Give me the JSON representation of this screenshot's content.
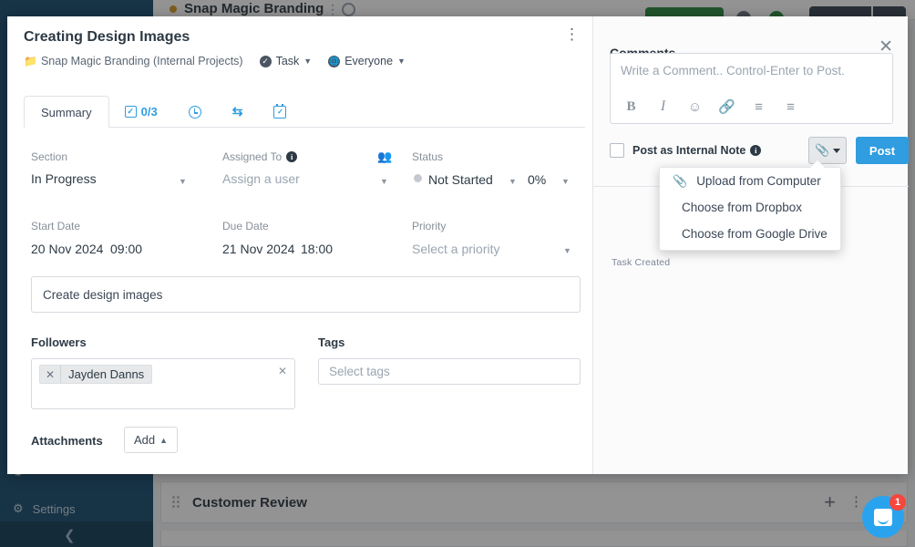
{
  "background": {
    "topbar": {
      "project_name": "Snap Magic Branding",
      "kebab": "⋮"
    },
    "sidebar": {
      "items": [
        {
          "label": "Settings",
          "icon": "gear-icon"
        }
      ]
    },
    "section_row": {
      "title": "Customer Review",
      "add": "+",
      "kebab": "⋮",
      "close": "✕"
    },
    "chat": {
      "badge": "1"
    }
  },
  "modal": {
    "title": "Creating Design Images",
    "kebab": "⋮",
    "breadcrumb": {
      "project": "Snap Magic Branding (Internal Projects)",
      "type": "Task",
      "visibility": "Everyone"
    },
    "tabs": [
      {
        "label": "Summary",
        "icon": ""
      },
      {
        "label": "0/3",
        "icon": "checkbox-icon"
      },
      {
        "label": "",
        "icon": "clock-icon"
      },
      {
        "label": "",
        "icon": "repeat-icon"
      },
      {
        "label": "",
        "icon": "calendar-icon"
      }
    ],
    "fields": {
      "section": {
        "label": "Section",
        "value": "In Progress"
      },
      "assigned_to": {
        "label": "Assigned To",
        "value": "Assign a user",
        "is_placeholder": true
      },
      "status": {
        "label": "Status",
        "value": "Not Started",
        "percent": "0%"
      },
      "start_date": {
        "label": "Start Date",
        "date": "20 Nov 2024",
        "time": "09:00"
      },
      "due_date": {
        "label": "Due Date",
        "date": "21 Nov 2024",
        "time": "18:00"
      },
      "priority": {
        "label": "Priority",
        "value": "Select a priority",
        "is_placeholder": true
      }
    },
    "description": "Create design images",
    "followers": {
      "label": "Followers",
      "chips": [
        "Jayden Danns"
      ]
    },
    "tags": {
      "label": "Tags",
      "placeholder": "Select tags"
    },
    "attachments": {
      "label": "Attachments",
      "add_button": "Add"
    }
  },
  "comments": {
    "title": "Comments",
    "placeholder": "Write a Comment.. Control-Enter to Post.",
    "toolbar": [
      {
        "name": "bold",
        "glyph": "B"
      },
      {
        "name": "italic",
        "glyph": "I"
      },
      {
        "name": "emoji",
        "glyph": "☺"
      },
      {
        "name": "link",
        "glyph": "🔗"
      },
      {
        "name": "ordered-list",
        "glyph": "☰"
      },
      {
        "name": "unordered-list",
        "glyph": "☰"
      }
    ],
    "internal_note_label": "Post as Internal Note",
    "post_button": "Post",
    "task_created": "Task Created",
    "attachment_menu": [
      {
        "label": "Upload from Computer",
        "icon": "paperclip-icon"
      },
      {
        "label": "Choose from Dropbox",
        "icon": ""
      },
      {
        "label": "Choose from Google Drive",
        "icon": ""
      }
    ]
  },
  "colors": {
    "accent": "#2f9de0",
    "sidebar": "#1b4f72",
    "green": "#2e8b42",
    "badge": "#f5473d"
  }
}
